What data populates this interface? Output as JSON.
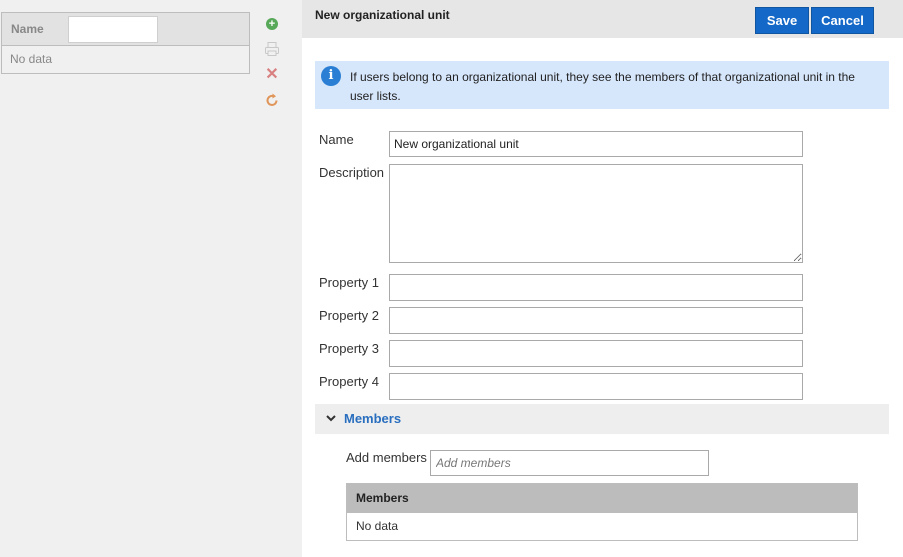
{
  "list": {
    "column_label": "Name",
    "filter_value": "",
    "empty_text": "No data"
  },
  "toolbar": {
    "add_icon": "plus-circle-icon",
    "print_icon": "printer-icon",
    "delete_icon": "close-icon",
    "refresh_icon": "refresh-icon",
    "add_glyph": "+",
    "delete_glyph": "✕"
  },
  "form": {
    "title": "New organizational unit",
    "save_label": "Save",
    "cancel_label": "Cancel",
    "info_glyph": "i",
    "info_text": "If users belong to an organizational unit, they see the members of that organizational unit in the user lists.",
    "name_label": "Name",
    "name_value": "New organizational unit",
    "description_label": "Description",
    "description_value": "",
    "property1_label": "Property 1",
    "property2_label": "Property 2",
    "property3_label": "Property 3",
    "property4_label": "Property 4",
    "property1_value": "",
    "property2_value": "",
    "property3_value": "",
    "property4_value": ""
  },
  "members": {
    "section_title": "Members",
    "add_label": "Add members",
    "add_placeholder": "Add members",
    "table_header": "Members",
    "empty_text": "No data"
  },
  "colors": {
    "accent": "#1468c7",
    "info_bg": "#d6e6fb",
    "link": "#2a6fbf"
  }
}
